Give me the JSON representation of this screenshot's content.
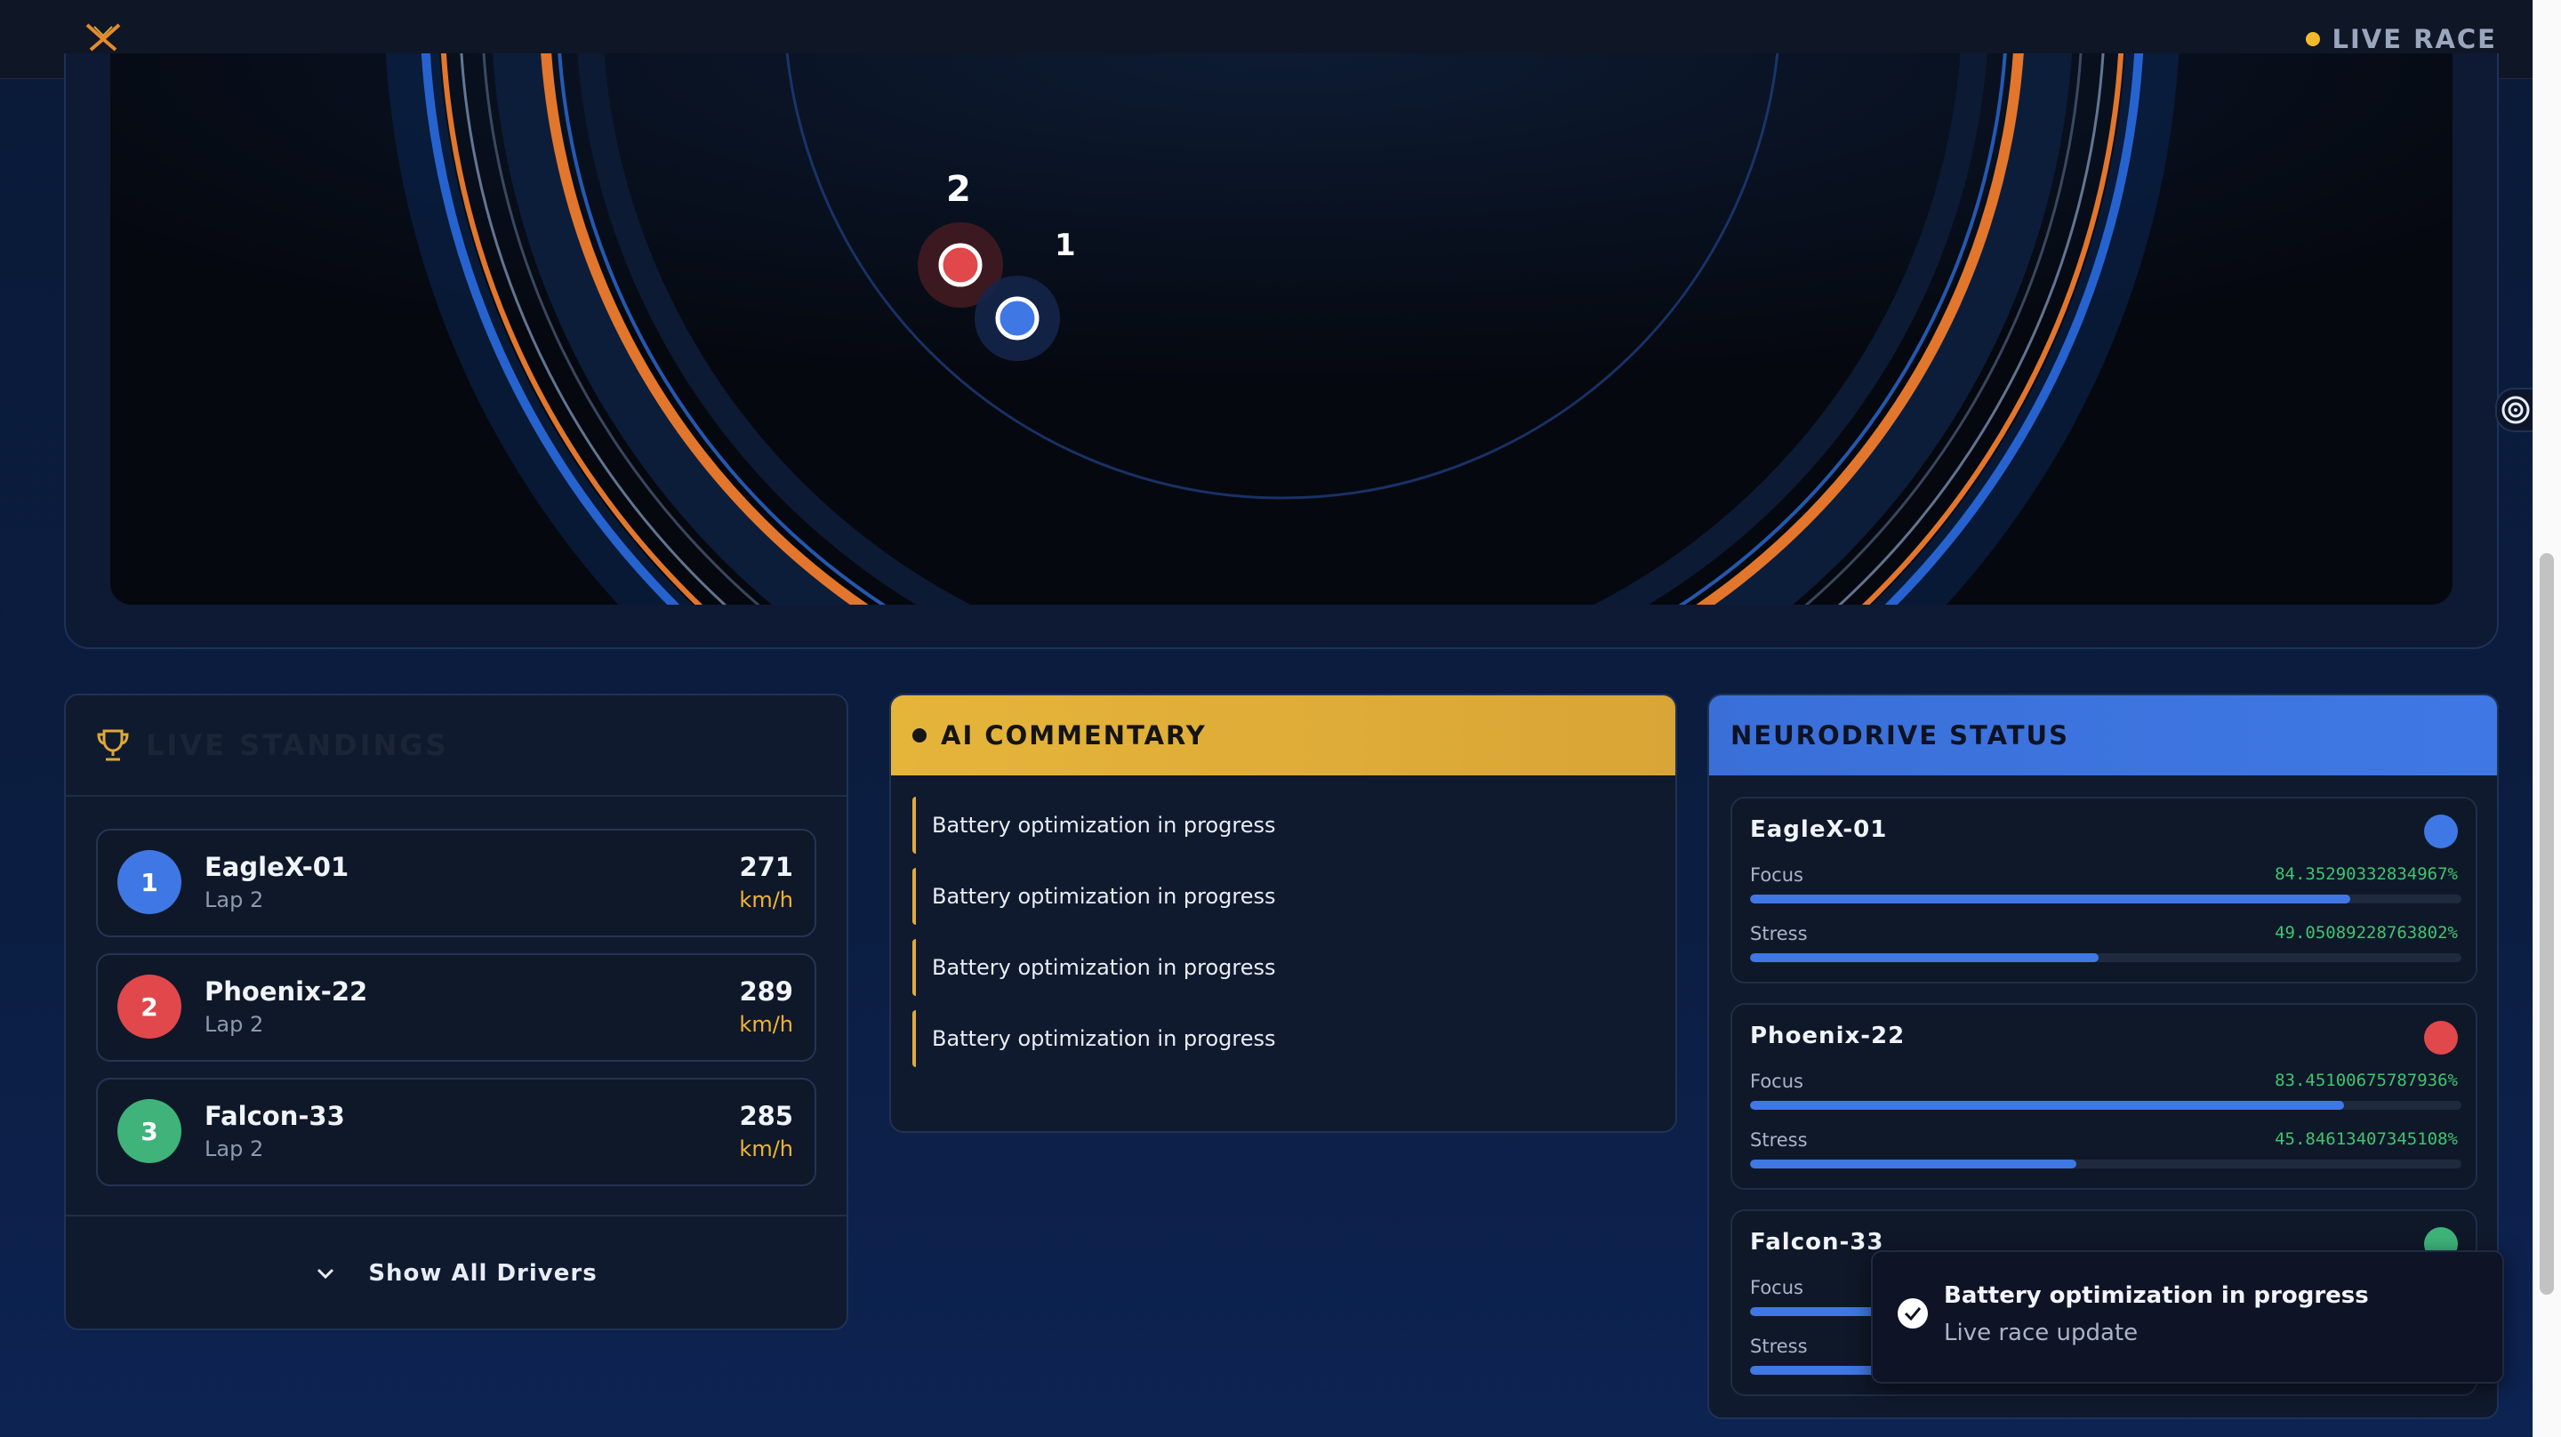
{
  "header": {
    "logo_icon": "crossed-wings-logo",
    "status_label": "LIVE RACE",
    "status_color": "#f3bb2c"
  },
  "track": {
    "markers": [
      {
        "label": "2",
        "color": "#e0484b"
      },
      {
        "label": "1",
        "color": "#3f78e4"
      }
    ]
  },
  "standings": {
    "title": "LIVE STANDINGS",
    "title_icon": "trophy-icon",
    "rows": [
      {
        "position": "1",
        "name": "EagleX-01",
        "lap": "Lap 2",
        "speed": "271",
        "unit": "km/h",
        "color": "#3f78e4"
      },
      {
        "position": "2",
        "name": "Phoenix-22",
        "lap": "Lap 2",
        "speed": "289",
        "unit": "km/h",
        "color": "#e0484b"
      },
      {
        "position": "3",
        "name": "Falcon-33",
        "lap": "Lap 2",
        "speed": "285",
        "unit": "km/h",
        "color": "#3fb37a"
      }
    ],
    "show_all_label": "Show All Drivers"
  },
  "commentary": {
    "title": "AI COMMENTARY",
    "items": [
      "Battery optimization in progress",
      "Battery optimization in progress",
      "Battery optimization in progress",
      "Battery optimization in progress"
    ]
  },
  "neurodrive": {
    "title": "NEURODRIVE STATUS",
    "drivers": [
      {
        "name": "EagleX-01",
        "color": "#3f78e4",
        "focus_label": "Focus",
        "focus_value": "84.35290332834967%",
        "focus": 84.35,
        "stress_label": "Stress",
        "stress_value": "49.05089228763802%",
        "stress": 49.05
      },
      {
        "name": "Phoenix-22",
        "color": "#e0484b",
        "focus_label": "Focus",
        "focus_value": "83.45100675787936%",
        "focus": 83.45,
        "stress_label": "Stress",
        "stress_value": "45.84613407345108%",
        "stress": 45.85
      },
      {
        "name": "Falcon-33",
        "color": "#3fb37a",
        "focus_label": "Focus",
        "focus_value": "",
        "focus": 80,
        "stress_label": "Stress",
        "stress_value": "",
        "stress": 45
      }
    ]
  },
  "toast": {
    "message": "Battery optimization in progress",
    "subtitle": "Live race update"
  }
}
